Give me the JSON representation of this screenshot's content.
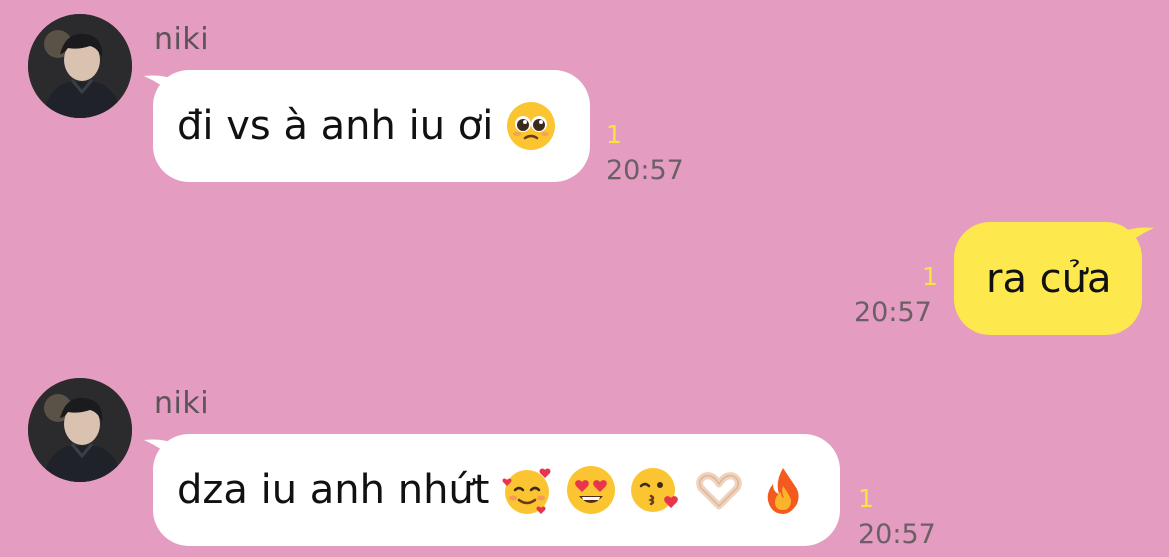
{
  "messages": [
    {
      "direction": "incoming",
      "sender": "niki",
      "text": "đi vs à anh iu ơi",
      "emojis": [
        "pleading-face-icon"
      ],
      "unread_count": "1",
      "time": "20:57"
    },
    {
      "direction": "outgoing",
      "text": "ra cửa",
      "unread_count": "1",
      "time": "20:57"
    },
    {
      "direction": "incoming",
      "sender": "niki",
      "text": "dza iu anh nhứt",
      "emojis": [
        "smiling-face-with-hearts-icon",
        "heart-eyes-icon",
        "face-blowing-kiss-icon",
        "heart-hands-icon",
        "fire-icon"
      ],
      "unread_count": "1",
      "time": "20:57"
    }
  ],
  "colors": {
    "background": "#e49cc0",
    "incoming_bubble": "#ffffff",
    "outgoing_bubble": "#fde84e",
    "unread": "#f7e53a"
  }
}
